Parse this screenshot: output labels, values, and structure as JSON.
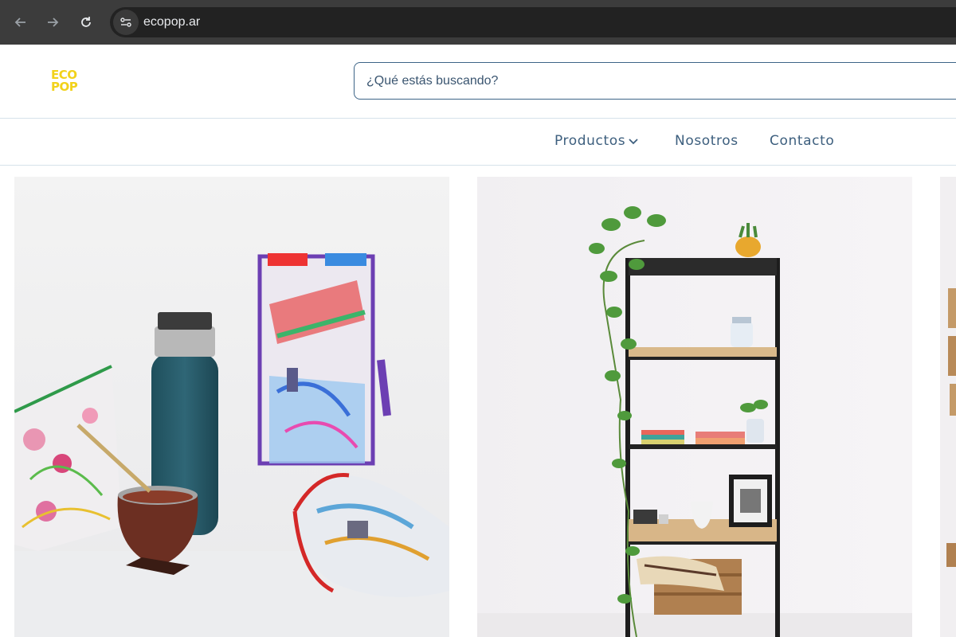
{
  "browser": {
    "url": "ecopop.ar",
    "icons": [
      "back-arrow-icon",
      "forward-arrow-icon",
      "reload-icon",
      "site-settings-icon"
    ]
  },
  "header": {
    "logo_line1": "ECO",
    "logo_line2": "POP",
    "search_placeholder": "¿Qué estás buscando?"
  },
  "nav": {
    "items": [
      {
        "label": "Productos",
        "has_dropdown": true
      },
      {
        "label": "Nosotros",
        "has_dropdown": false
      },
      {
        "label": "Contacto",
        "has_dropdown": false
      }
    ]
  },
  "products": [
    {
      "image": "mate-and-recycled-bags-photo"
    },
    {
      "image": "metal-shelf-with-plants-photo"
    },
    {
      "image": "wooden-product-photo-partial"
    }
  ],
  "colors": {
    "chrome_bg": "#3c3c3c",
    "omnibox_bg": "#222222",
    "accent": "#3d6487",
    "nav_text": "#3d5f7e",
    "logo_yellow": "#f2d21a"
  }
}
